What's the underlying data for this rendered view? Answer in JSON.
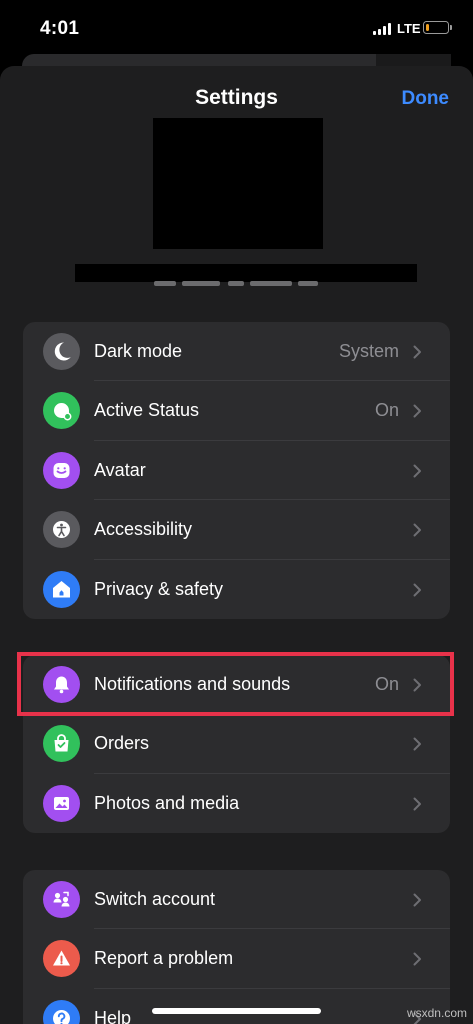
{
  "status_bar": {
    "time": "4:01",
    "network": "LTE",
    "battery_level": 0.15
  },
  "header": {
    "title": "Settings",
    "done_label": "Done"
  },
  "colors": {
    "accent": "#3d8bff",
    "highlight": "#e8324a",
    "icon_gray": "#5a5a5e",
    "icon_green": "#31c15c",
    "icon_purple": "#a24ff0",
    "icon_blue": "#2f7cf6",
    "icon_red": "#ec5b4c"
  },
  "groups": [
    {
      "rows": [
        {
          "label": "Dark mode",
          "value": "System",
          "icon": "moon-icon"
        },
        {
          "label": "Active Status",
          "value": "On",
          "icon": "active-status-icon"
        },
        {
          "label": "Avatar",
          "value": "",
          "icon": "avatar-icon"
        },
        {
          "label": "Accessibility",
          "value": "",
          "icon": "accessibility-icon"
        },
        {
          "label": "Privacy & safety",
          "value": "",
          "icon": "home-shield-icon"
        }
      ]
    },
    {
      "rows": [
        {
          "label": "Notifications and sounds",
          "value": "On",
          "icon": "bell-icon"
        },
        {
          "label": "Orders",
          "value": "",
          "icon": "shopping-bag-icon"
        },
        {
          "label": "Photos and media",
          "value": "",
          "icon": "photo-icon"
        }
      ]
    },
    {
      "rows": [
        {
          "label": "Switch account",
          "value": "",
          "icon": "switch-account-icon"
        },
        {
          "label": "Report a problem",
          "value": "",
          "icon": "warning-icon"
        },
        {
          "label": "Help",
          "value": "",
          "icon": "help-icon"
        }
      ]
    }
  ],
  "watermark": "wsxdn.com"
}
